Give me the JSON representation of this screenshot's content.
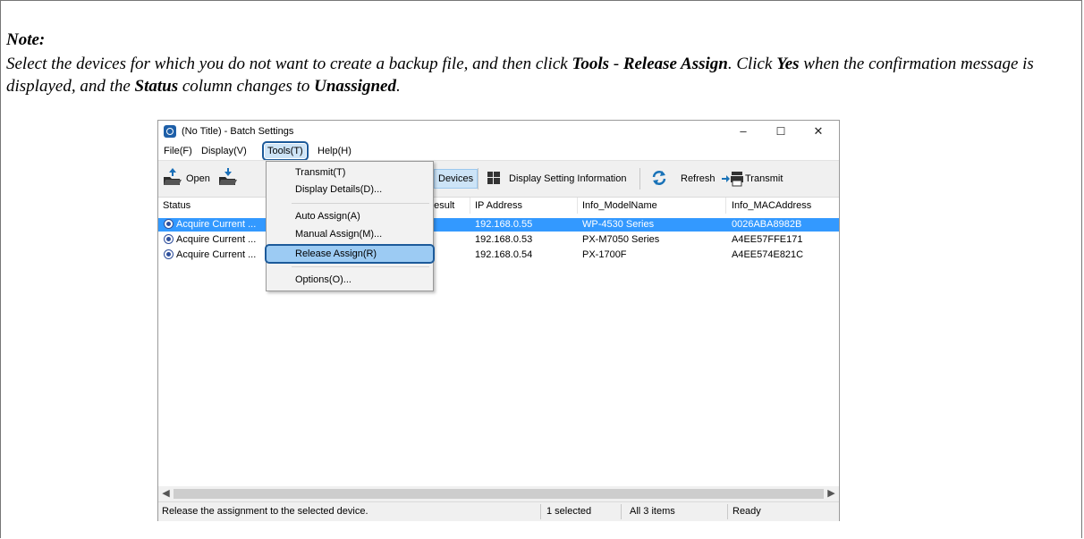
{
  "note": {
    "title": "Note:",
    "p1": "Select the devices for which you do not want to create a backup file, and then click ",
    "tools": "Tools",
    "dash": " - ",
    "release_assign": "Release Assign",
    "p2": ". Click ",
    "yes": "Yes",
    "p3": " when the confirmation message is displayed, and the ",
    "status": "Status",
    "p4": " column changes to ",
    "unassigned": "Unassigned",
    "p5": "."
  },
  "window": {
    "title": "(No Title) - Batch Settings",
    "minimize": "–",
    "maximize": "☐",
    "close": "✕"
  },
  "menu": {
    "file": "File(F)",
    "display": "Display(V)",
    "tools": "Tools(T)",
    "help": "Help(H)"
  },
  "toolbar": {
    "open": "Open",
    "devices": "Devices",
    "display_setting_information": "Display Setting Information",
    "refresh": "Refresh",
    "transmit": "Transmit"
  },
  "columns": {
    "status": "Status",
    "result": "n Result",
    "ip": "IP Address",
    "model": "Info_ModelName",
    "mac": "Info_MACAddress"
  },
  "rows": [
    {
      "status": "Acquire Current ...",
      "ip": "192.168.0.55",
      "model": "WP-4530 Series",
      "mac": "0026ABA8982B"
    },
    {
      "status": "Acquire Current ...",
      "ip": "192.168.0.53",
      "model": "PX-M7050 Series",
      "mac": "A4EE57FFE171"
    },
    {
      "status": "Acquire Current ...",
      "ip": "192.168.0.54",
      "model": "PX-1700F",
      "mac": "A4EE574E821C"
    }
  ],
  "tools_menu": {
    "transmit": "Transmit(T)",
    "display_details": "Display Details(D)...",
    "auto_assign": "Auto Assign(A)",
    "manual_assign": "Manual Assign(M)...",
    "release_assign": "Release Assign(R)",
    "options": "Options(O)..."
  },
  "statusbar": {
    "message": "Release the assignment to the selected device.",
    "selected": "1 selected",
    "items": "All 3 items",
    "state": "Ready"
  },
  "colors": {
    "selection": "#3399ff",
    "highlight_outline": "#1c5a9a"
  }
}
